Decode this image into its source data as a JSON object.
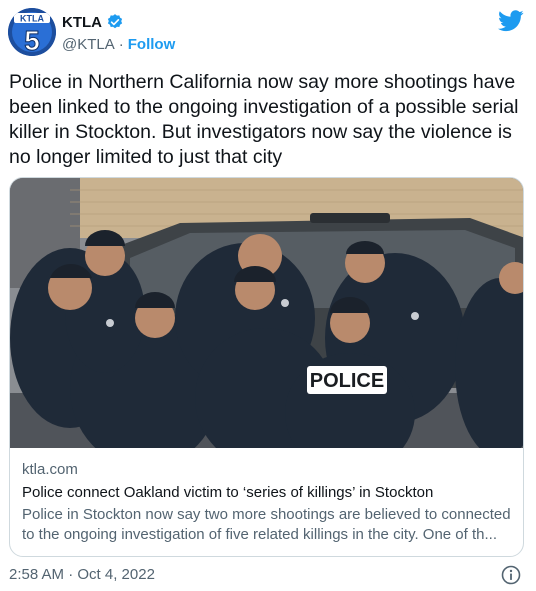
{
  "account": {
    "display_name": "KTLA",
    "handle": "@KTLA",
    "separator": "·",
    "follow_label": "Follow",
    "avatar_logo_text": "KTLA",
    "avatar_number": "5"
  },
  "tweet": {
    "text": "Police in Northern California now say more shootings have been linked to the ongoing investigation of a possible serial killer in Stockton. But investigators now say the violence is no longer limited to just that city",
    "timestamp": "2:58 AM · Oct 4, 2022"
  },
  "card": {
    "image_sign_text": "POLICE",
    "domain": "ktla.com",
    "title": "Police connect Oakland victim to ‘series of killings’ in Stockton",
    "description": "Police in Stockton now say two more shootings are believed to connected to the ongoing investigation of five related killings in the city. One of th..."
  },
  "icons": {
    "verified": "verified-badge-icon",
    "twitter": "twitter-bird-icon",
    "info": "info-icon"
  },
  "colors": {
    "accent": "#1d9bf0",
    "text": "#0f1419",
    "muted": "#536471",
    "border": "#cfd9de"
  }
}
